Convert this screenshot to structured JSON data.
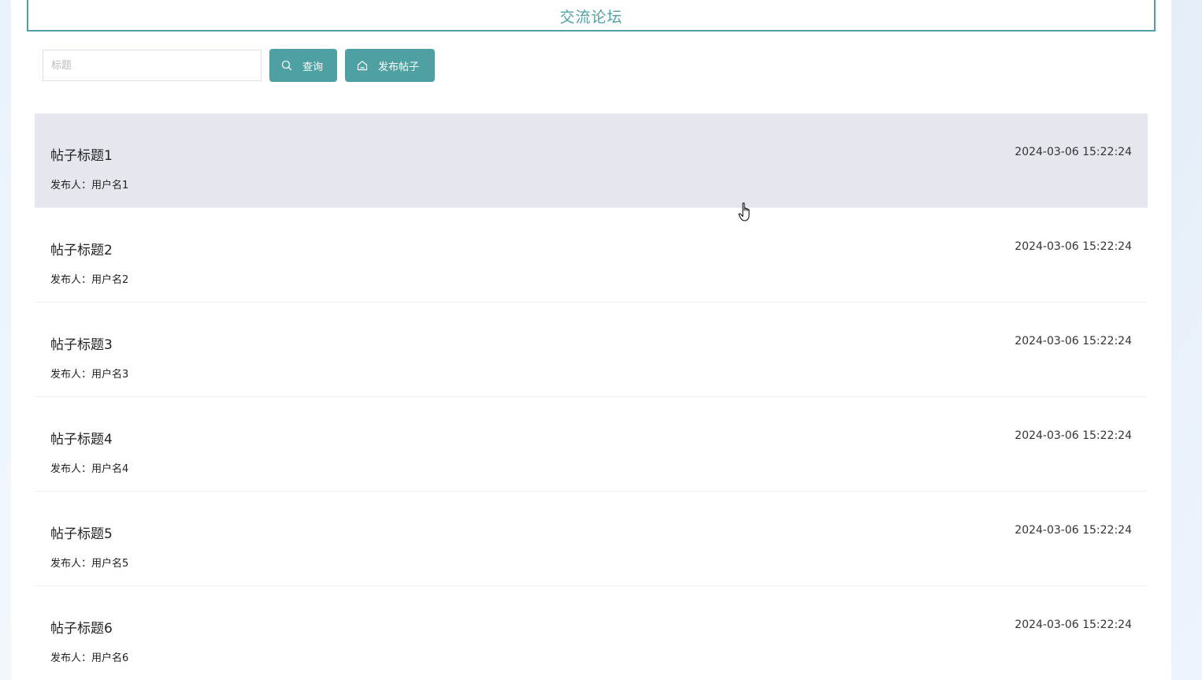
{
  "header": {
    "title": "交流论坛"
  },
  "search": {
    "placeholder": "标题",
    "value": "",
    "search_button_label": "查询",
    "post_button_label": "发布帖子"
  },
  "posts": [
    {
      "title": "帖子标题1",
      "author_label": "发布人：",
      "author": "用户名1",
      "time": "2024-03-06 15:22:24"
    },
    {
      "title": "帖子标题2",
      "author_label": "发布人：",
      "author": "用户名2",
      "time": "2024-03-06 15:22:24"
    },
    {
      "title": "帖子标题3",
      "author_label": "发布人：",
      "author": "用户名3",
      "time": "2024-03-06 15:22:24"
    },
    {
      "title": "帖子标题4",
      "author_label": "发布人：",
      "author": "用户名4",
      "time": "2024-03-06 15:22:24"
    },
    {
      "title": "帖子标题5",
      "author_label": "发布人：",
      "author": "用户名5",
      "time": "2024-03-06 15:22:24"
    },
    {
      "title": "帖子标题6",
      "author_label": "发布人：",
      "author": "用户名6",
      "time": "2024-03-06 15:22:24"
    }
  ],
  "colors": {
    "accent": "#4fa0a3",
    "hover_row": "#e4e7ee"
  },
  "icons": {
    "search_button": "search-icon",
    "post_button": "home-icon"
  }
}
